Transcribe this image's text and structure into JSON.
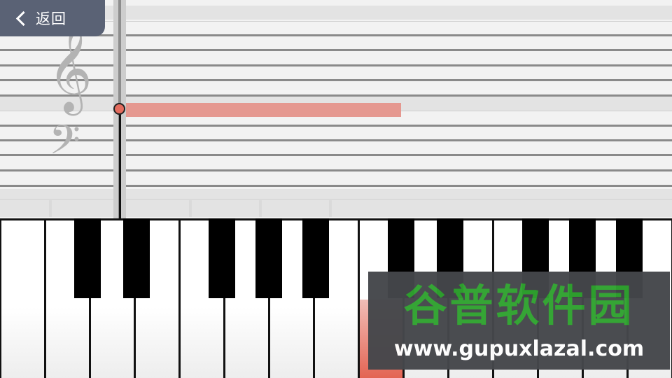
{
  "header": {
    "back_label": "返回"
  },
  "staff": {
    "treble_clef_glyph": "𝄞",
    "bass_clef_glyph": "𝄢"
  },
  "playback": {
    "current_note_color": "#e59890",
    "playhead_color": "#e46c5e"
  },
  "watermark": {
    "title": "谷普软件园",
    "url": "www.gupuxlazal.com"
  },
  "colors": {
    "header_bg": "#5a6275",
    "watermark_green": "#2fa32f"
  }
}
